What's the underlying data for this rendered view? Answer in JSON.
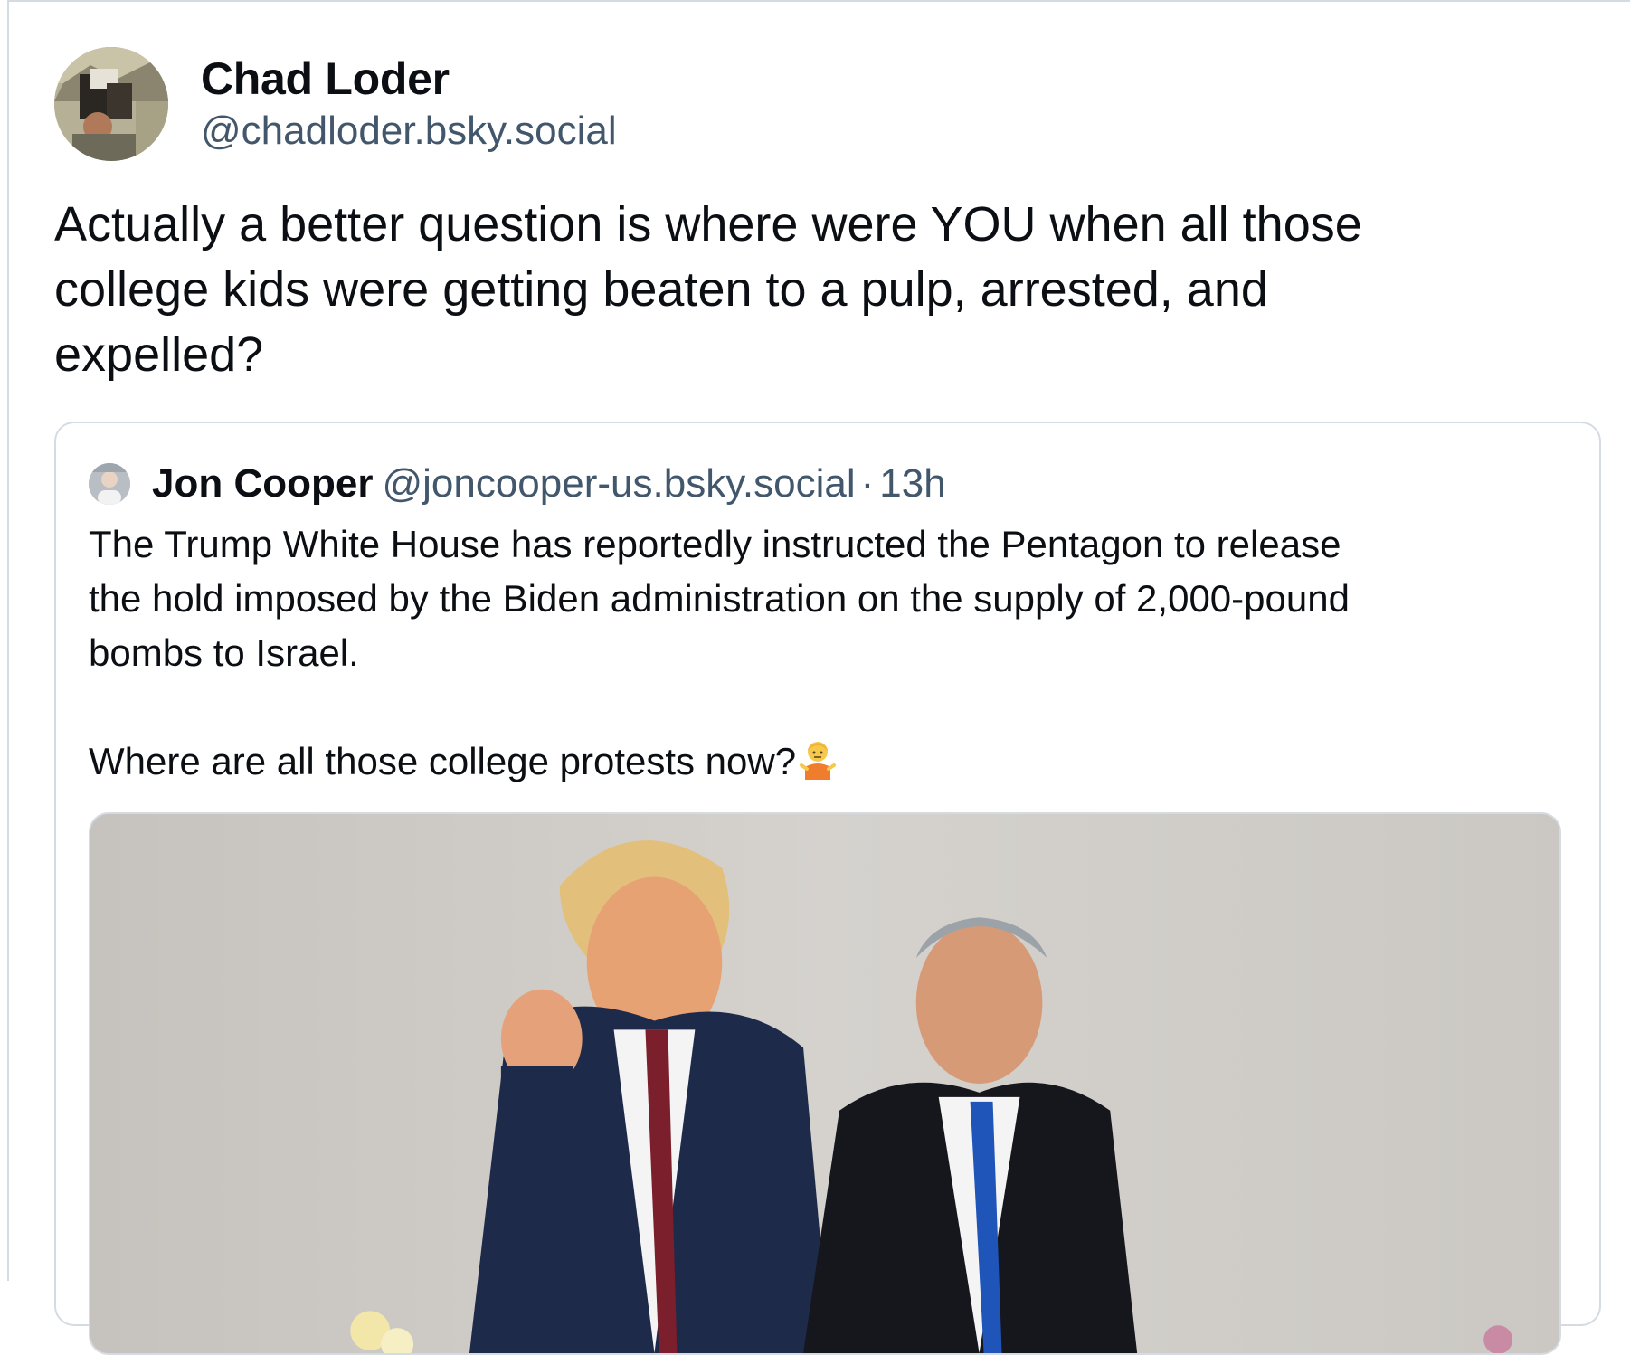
{
  "post": {
    "author": {
      "display_name": "Chad Loder",
      "handle": "@chadloder.bsky.social"
    },
    "text": "Actually a better question is where were YOU when all those\ncollege kids were getting beaten to a pulp, arrested, and\nexpelled?"
  },
  "quoted_post": {
    "author": {
      "display_name": "Jon Cooper",
      "handle": "@joncooper-us.bsky.social"
    },
    "separator": "·",
    "time": "13h",
    "text": "The Trump White House has reportedly instructed the Pentagon to release\nthe hold imposed by the Biden administration on the supply of 2,000-pound\nbombs to Israel.\n\nWhere are all those college protests now?",
    "emoji": "person-shrugging-emoji"
  },
  "colors": {
    "text_primary": "#0b0f14",
    "text_secondary": "#42576c",
    "border": "#d4dbe2"
  }
}
